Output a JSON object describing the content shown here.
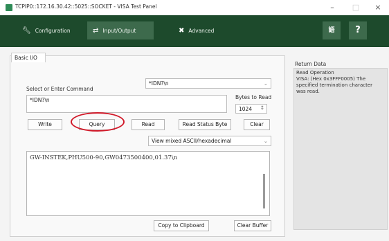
{
  "window": {
    "title": "TCPIP0::172.16.30.42::5025::SOCKET - VISA Test Panel",
    "controls": [
      "–",
      "□",
      "×"
    ]
  },
  "toolbar": {
    "configuration": "Configuration",
    "input_output": "Input/Output",
    "advanced": "Advanced",
    "help": "?",
    "accent": "#1d4a2c"
  },
  "tabs": {
    "basic_io": "Basic I/O"
  },
  "command": {
    "label": "Select or Enter Command",
    "combo_value": "*IDN?\\n",
    "text": "*IDN?\\n",
    "bytes_label": "Bytes to Read",
    "bytes_value": "1024"
  },
  "buttons": {
    "write": "Write",
    "query": "Query",
    "read": "Read",
    "read_status": "Read Status Byte",
    "clear": "Clear",
    "copy": "Copy to Clipboard",
    "clear_buffer": "Clear Buffer"
  },
  "view_mode": "View mixed ASCII/hexadecimal",
  "response": "GW-INSTEK,PHU500-90,GW0473500400,01.37\\n",
  "return_data": {
    "title": "Return Data",
    "lines": [
      "Read Operation",
      "VISA:  (Hex 0x3FFF0005) The",
      "specified termination character",
      "was read."
    ]
  },
  "highlight_color": "#d11a2a"
}
